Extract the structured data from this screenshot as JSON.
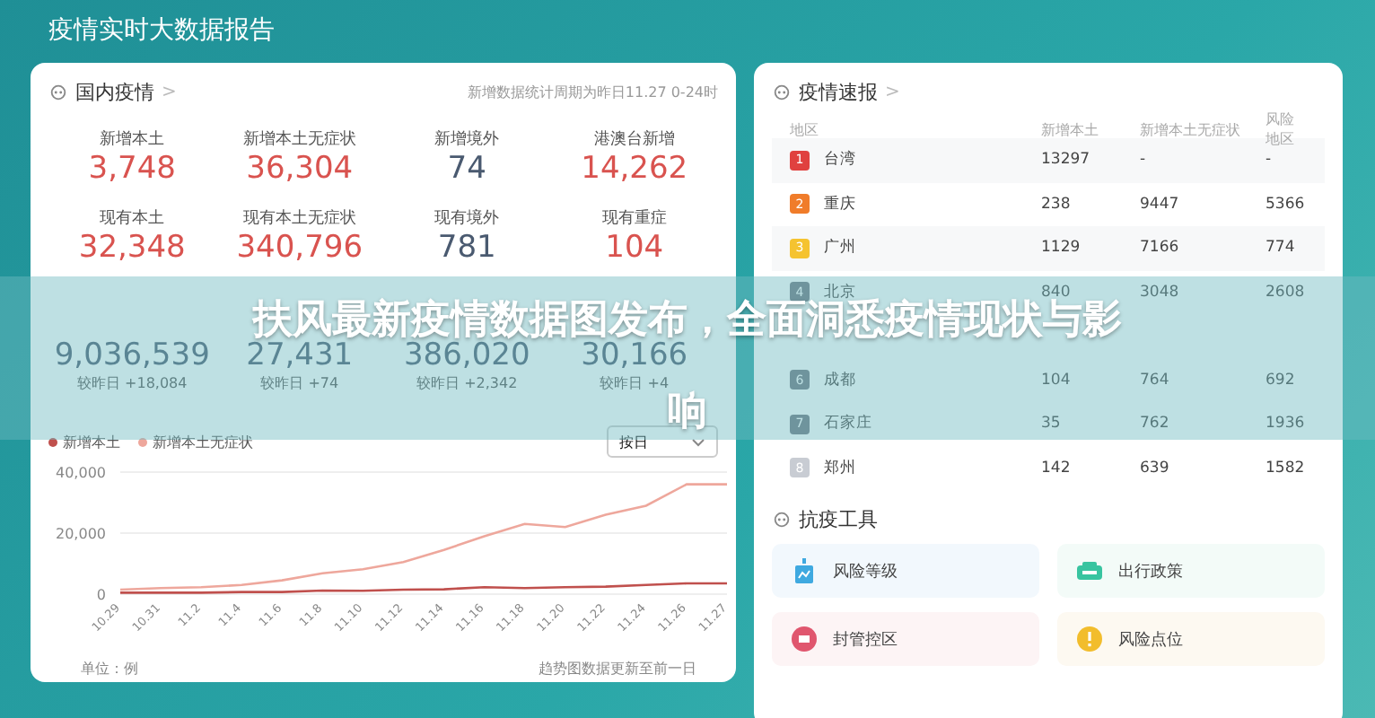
{
  "page_title": "疫情实时大数据报告",
  "domestic": {
    "title": "国内疫情",
    "chevron": ">",
    "note": "新增数据统计周期为昨日11.27 0-24时",
    "stats": [
      {
        "label": "新增本土",
        "value": "3,748",
        "color": "#d9534f"
      },
      {
        "label": "新增本土无症状",
        "value": "36,304",
        "color": "#d9534f"
      },
      {
        "label": "新增境外",
        "value": "74",
        "color": "#4a5a70"
      },
      {
        "label": "港澳台新增",
        "value": "14,262",
        "color": "#d9534f"
      },
      {
        "label": "现有本土",
        "value": "32,348",
        "color": "#d9534f"
      },
      {
        "label": "现有本土无症状",
        "value": "340,796",
        "color": "#d9534f"
      },
      {
        "label": "现有境外",
        "value": "781",
        "color": "#4a5a70"
      },
      {
        "label": "现有重症",
        "value": "104",
        "color": "#d9534f"
      },
      {
        "value": "9,036,539",
        "change": "较昨日 +18,084"
      },
      {
        "value": "27,431",
        "change": "较昨日 +74"
      },
      {
        "value": "386,020",
        "change": "较昨日 +2,342"
      },
      {
        "value": "30,166",
        "change": "较昨日 +4"
      }
    ],
    "period_select": {
      "value": "按日"
    },
    "chart_data": {
      "type": "line",
      "categories": [
        "10.29",
        "10.31",
        "11.2",
        "11.4",
        "11.6",
        "11.8",
        "11.10",
        "11.12",
        "11.14",
        "11.16",
        "11.18",
        "11.20",
        "11.22",
        "11.24",
        "11.26",
        "11.27"
      ],
      "yticks": [
        {
          "value": 0,
          "label": "0"
        },
        {
          "value": 20000,
          "label": "20,000"
        },
        {
          "value": 40000,
          "label": "40,000"
        }
      ],
      "ylim": [
        0,
        40000
      ],
      "series": [
        {
          "name": "新增本土",
          "color": "#c0504d",
          "values": [
            500,
            500,
            500,
            700,
            700,
            1200,
            1100,
            1500,
            1600,
            2300,
            2000,
            2300,
            2500,
            3000,
            3500,
            3500
          ]
        },
        {
          "name": "新增本土无症状",
          "color": "#eea79c",
          "values": [
            1500,
            2000,
            2300,
            3000,
            4500,
            6800,
            8200,
            10500,
            14500,
            19000,
            23000,
            22000,
            26000,
            29000,
            36000,
            36000
          ]
        }
      ]
    },
    "unit": "单位：例",
    "update_note": "趋势图数据更新至前一日"
  },
  "bulletin": {
    "title": "疫情速报",
    "chevron": ">",
    "columns": [
      "地区",
      "新增本土",
      "新增本土无症状",
      "风险地区"
    ],
    "rows": [
      {
        "rank": "1",
        "color": "#e0413f",
        "region": "台湾",
        "local": "13297",
        "asymptomatic": "-",
        "risk": "-"
      },
      {
        "rank": "2",
        "color": "#f07c2a",
        "region": "重庆",
        "local": "238",
        "asymptomatic": "9447",
        "risk": "5366"
      },
      {
        "rank": "3",
        "color": "#f5c330",
        "region": "广州",
        "local": "1129",
        "asymptomatic": "7166",
        "risk": "774"
      },
      {
        "rank": "4",
        "region": "北京",
        "local": "840",
        "asymptomatic": "3048",
        "risk": "2608"
      },
      {},
      {
        "rank": "6",
        "region": "成都",
        "local": "104",
        "asymptomatic": "764",
        "risk": "692"
      },
      {
        "rank": "7",
        "region": "石家庄",
        "local": "35",
        "asymptomatic": "762",
        "risk": "1936"
      },
      {
        "rank": "8",
        "color": "#c8ccd3",
        "region": "郑州",
        "local": "142",
        "asymptomatic": "639",
        "risk": "1582"
      }
    ]
  },
  "tools": {
    "title": "抗疫工具",
    "items": [
      {
        "label": "风险等级",
        "kind": "level",
        "color": "#3fa9e0"
      },
      {
        "label": "出行政策",
        "kind": "travel",
        "color": "#38c4a0"
      },
      {
        "label": "封管控区",
        "kind": "zone",
        "color": "#e0566e"
      },
      {
        "label": "风险点位",
        "kind": "point",
        "color": "#f2bd2c"
      }
    ]
  },
  "banner": {
    "lines": [
      "扶风最新疫情数据图发布，全面洞悉疫情现状与影",
      "响"
    ]
  }
}
